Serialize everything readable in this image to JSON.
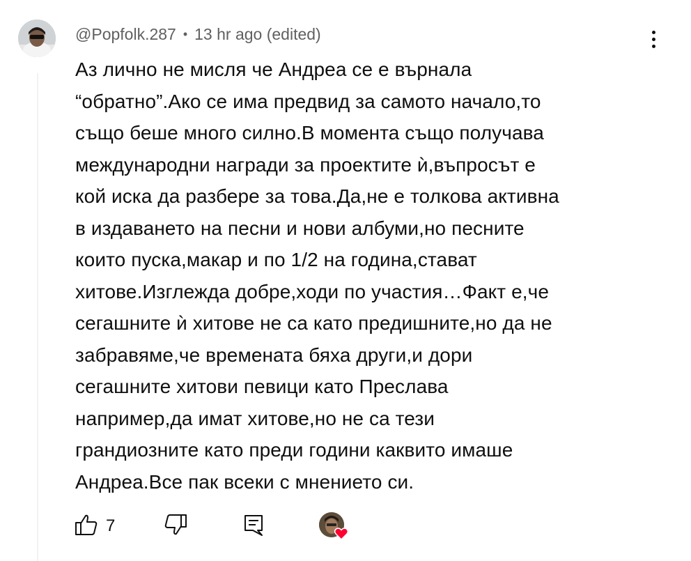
{
  "comment": {
    "author": "@Popfolk.287",
    "separator": "•",
    "time": "13 hr ago (edited)",
    "text": "Аз лично не мисля че Андреа се е върнала\n“обратно”.Ако се има предвид за самото начало,то\nсъщо беше много силно.В момента също получава\nмеждународни награди за проектите ѝ,въпросът е\nкой иска да разбере за това.Да,не е толкова активна\nв издаването на песни и нови албуми,но песните\nкоито пуска,макар и по 1/2 на година,стават\nхитове.Изглежда добре,ходи по участия…Факт е,че\nсегашните ѝ хитове не са като предишните,но да не\nзабравяме,че времената бяха други,и дори\nсегашните хитови певици като Преслава\nнапример,да имат хитове,но не са тези\nграндиозните като преди години каквито имаше\nАндреа.Все пак всеки с мнението си.",
    "like_count": "7"
  },
  "icons": {
    "menu": "more-vertical-icon",
    "like": "thumbs-up-icon",
    "dislike": "thumbs-down-icon",
    "reply": "reply-comment-icon",
    "creator_heart": "heart-icon"
  },
  "colors": {
    "text": "#0f0f0f",
    "meta": "#606060",
    "heart": "#ff0033"
  }
}
